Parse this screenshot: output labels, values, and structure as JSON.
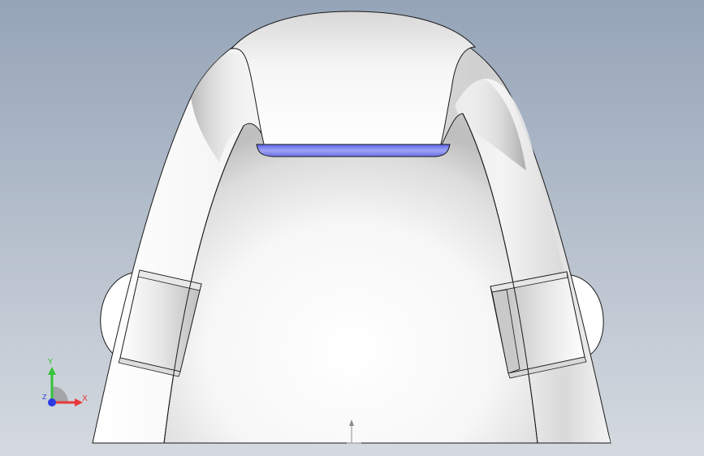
{
  "viewport": {
    "background_top": "#97a6b9",
    "background_bottom": "#d3d9df",
    "edge_color": "#1a1a1a",
    "accent_face_color": "#7f86f0"
  },
  "triad": {
    "x_label": "X",
    "y_label": "Y",
    "z_label": "Z",
    "x_color": "#e8383a",
    "y_color": "#34c43a",
    "z_color": "#2a3ae0"
  }
}
